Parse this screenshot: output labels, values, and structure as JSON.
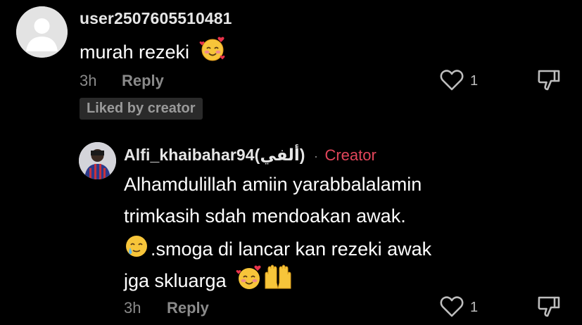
{
  "comment": {
    "username": "user2507605510481",
    "text": "murah rezeki",
    "time": "3h",
    "reply_label": "Reply",
    "like_count": "1",
    "liked_badge": "Liked by creator"
  },
  "reply": {
    "username": "Alfi_khaibahar94(ألفي)",
    "separator": "·",
    "creator_label": "Creator",
    "lines": [
      "Alhamdulillah amiin yarabbalalamin",
      "trimkasih sdah mendoakan awak.",
      ".smoga di lancar kan rezeki awak",
      "jga skluarga"
    ],
    "time": "3h",
    "reply_label": "Reply",
    "like_count": "1"
  },
  "colors": {
    "background": "#000000",
    "creator_accent": "#e3465b",
    "muted_text": "#8a8a8a",
    "badge_bg": "#2a2a2a"
  },
  "icons": {
    "comment_emoji": "smiling-face-with-hearts",
    "line3_emoji": "smiling-face-with-tear",
    "line4_emojis": [
      "smiling-face-with-hearts",
      "palms-up-together"
    ],
    "like": "heart-outline-icon",
    "dislike": "thumbs-down-outline-icon"
  }
}
